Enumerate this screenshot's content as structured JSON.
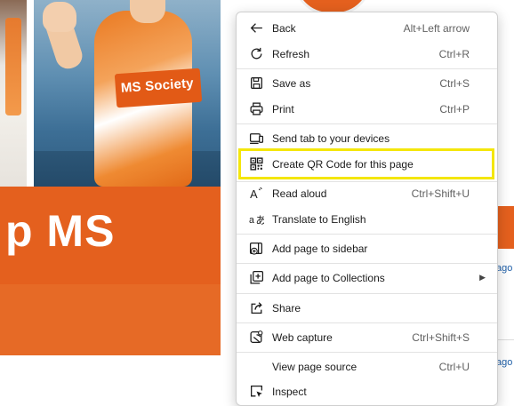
{
  "page": {
    "badge_text": "MS Society",
    "heading_text": "p MS",
    "side_links": [
      "ago",
      "ago"
    ]
  },
  "menu": {
    "items": [
      {
        "label": "Back",
        "shortcut": "Alt+Left arrow",
        "icon": "back-arrow-icon"
      },
      {
        "label": "Refresh",
        "shortcut": "Ctrl+R",
        "icon": "refresh-icon"
      },
      {
        "label": "Save as",
        "shortcut": "Ctrl+S",
        "icon": "save-icon"
      },
      {
        "label": "Print",
        "shortcut": "Ctrl+P",
        "icon": "print-icon"
      },
      {
        "label": "Send tab to your devices",
        "shortcut": "",
        "icon": "devices-icon"
      },
      {
        "label": "Create QR Code for this page",
        "shortcut": "",
        "icon": "qr-code-icon",
        "highlighted": true
      },
      {
        "label": "Read aloud",
        "shortcut": "Ctrl+Shift+U",
        "icon": "read-aloud-icon"
      },
      {
        "label": "Translate to English",
        "shortcut": "",
        "icon": "translate-icon"
      },
      {
        "label": "Add page to sidebar",
        "shortcut": "",
        "icon": "add-sidebar-icon"
      },
      {
        "label": "Add page to Collections",
        "shortcut": "",
        "icon": "collections-icon",
        "submenu": true
      },
      {
        "label": "Share",
        "shortcut": "",
        "icon": "share-icon"
      },
      {
        "label": "Web capture",
        "shortcut": "Ctrl+Shift+S",
        "icon": "web-capture-icon"
      },
      {
        "label": "View page source",
        "shortcut": "Ctrl+U",
        "icon": ""
      },
      {
        "label": "Inspect",
        "shortcut": "",
        "icon": "inspect-icon"
      }
    ],
    "highlight_color": "#f4e60b"
  },
  "colors": {
    "brand_orange": "#e4601e",
    "link_blue": "#1f5fa8"
  }
}
